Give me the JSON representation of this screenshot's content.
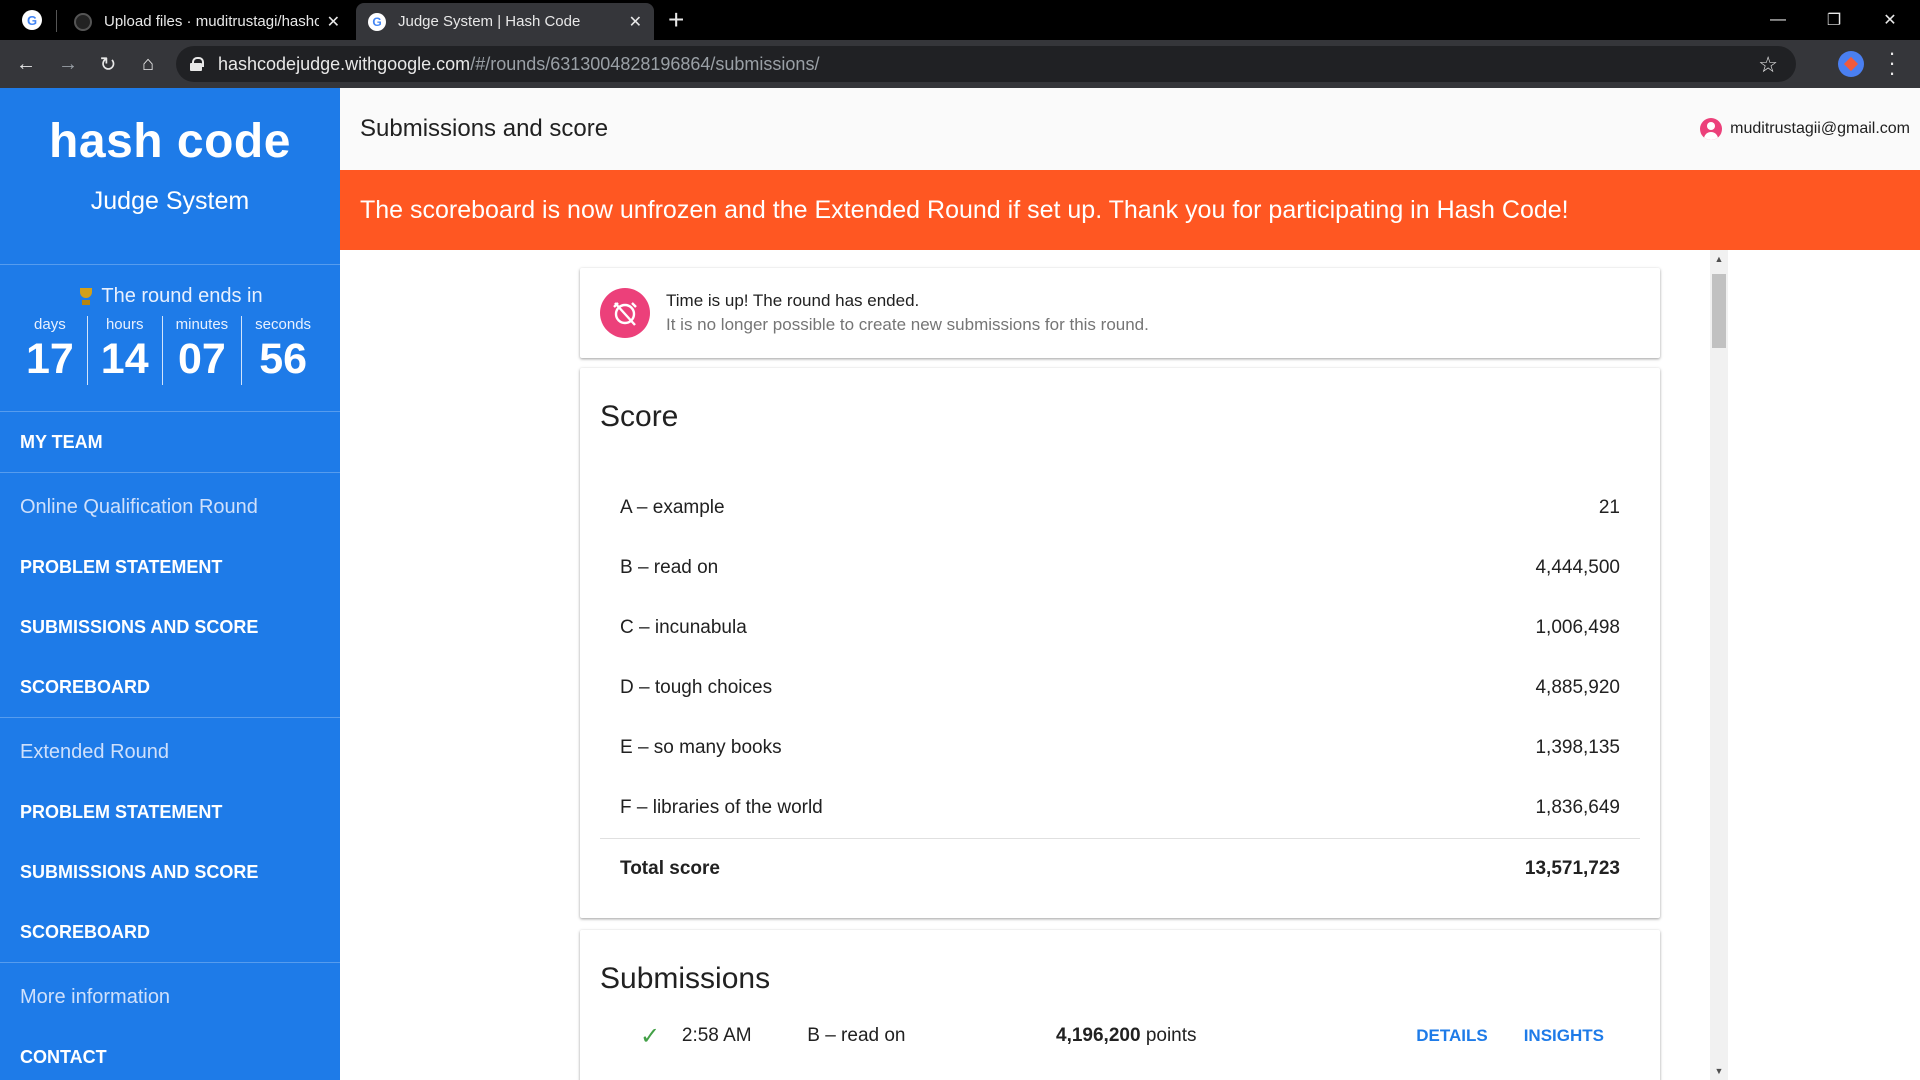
{
  "browser": {
    "tabs": [
      {
        "title": "Upload files · muditrustagi/hashc",
        "active": false
      },
      {
        "title": "Judge System | Hash Code",
        "active": true
      }
    ],
    "url_host": "hashcodejudge.withgoogle.com",
    "url_path": "/#/rounds/6313004828196864/submissions/"
  },
  "sidebar": {
    "logo": "hash code",
    "subtitle": "Judge System",
    "timer": {
      "heading": "The round ends in",
      "units": [
        {
          "label": "days",
          "value": "17"
        },
        {
          "label": "hours",
          "value": "14"
        },
        {
          "label": "minutes",
          "value": "07"
        },
        {
          "label": "seconds",
          "value": "56"
        }
      ]
    },
    "my_team": "MY TEAM",
    "sections": [
      {
        "title": "Online Qualification Round",
        "items": [
          "PROBLEM STATEMENT",
          "SUBMISSIONS AND SCORE",
          "SCOREBOARD"
        ]
      },
      {
        "title": "Extended Round",
        "items": [
          "PROBLEM STATEMENT",
          "SUBMISSIONS AND SCORE",
          "SCOREBOARD"
        ]
      },
      {
        "title": "More information",
        "items": [
          "CONTACT"
        ]
      }
    ]
  },
  "header": {
    "title": "Submissions and score",
    "user_email": "muditrustagii@gmail.com"
  },
  "banner": "The scoreboard is now unfrozen and the Extended Round if set up. Thank you for participating in Hash Code!",
  "time_up": {
    "title": "Time is up! The round has ended.",
    "message": "It is no longer possible to create new submissions for this round."
  },
  "score": {
    "heading": "Score",
    "rows": [
      {
        "name": "A – example",
        "value": "21"
      },
      {
        "name": "B – read on",
        "value": "4,444,500"
      },
      {
        "name": "C – incunabula",
        "value": "1,006,498"
      },
      {
        "name": "D – tough choices",
        "value": "4,885,920"
      },
      {
        "name": "E – so many books",
        "value": "1,398,135"
      },
      {
        "name": "F – libraries of the world",
        "value": "1,836,649"
      }
    ],
    "total_label": "Total score",
    "total_value": "13,571,723"
  },
  "submissions": {
    "heading": "Submissions",
    "rows": [
      {
        "time": "2:58 AM",
        "dataset": "B – read on",
        "points": "4,196,200",
        "points_suffix": " points",
        "details": "DETAILS",
        "insights": "INSIGHTS"
      }
    ]
  },
  "colors": {
    "sidebar": "#1e7be8",
    "banner": "#ff5722",
    "accent": "#ec407a",
    "link": "#1e7be8"
  }
}
